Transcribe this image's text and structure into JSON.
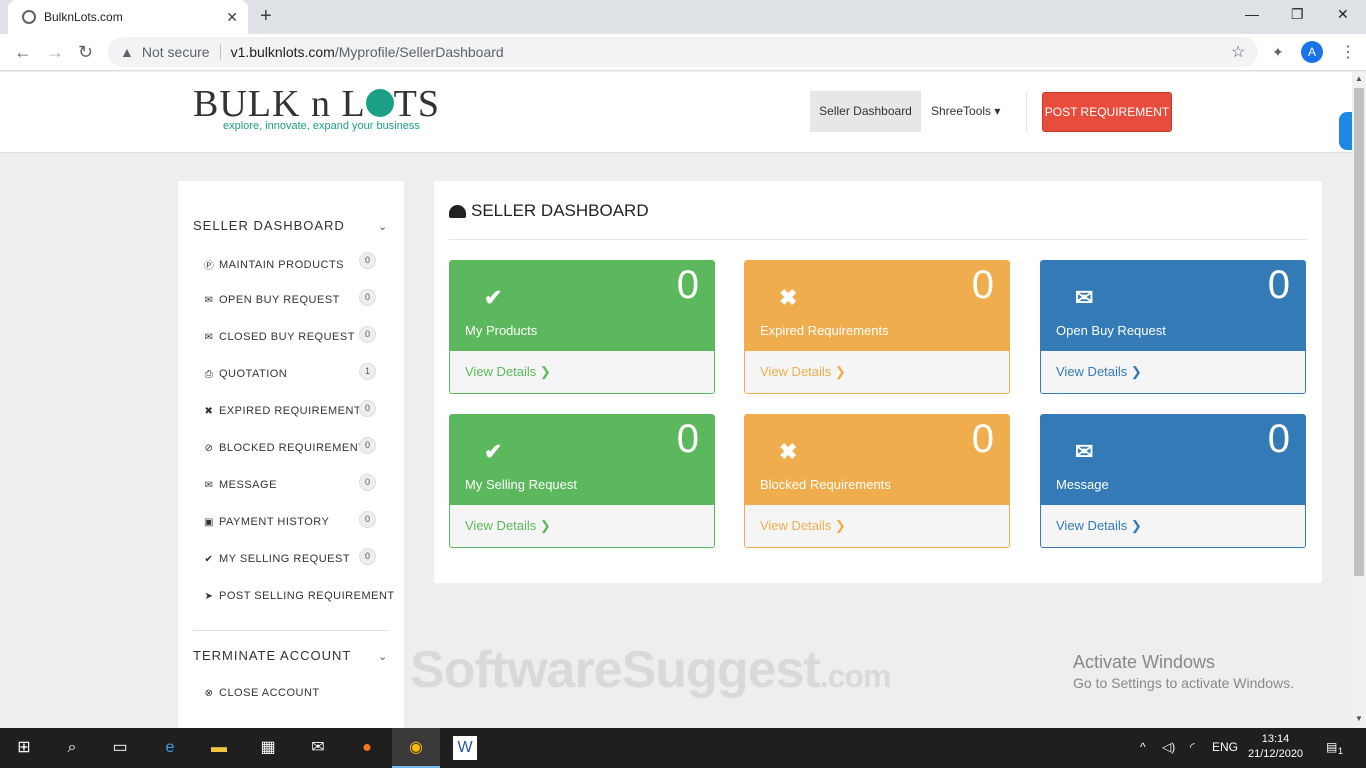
{
  "browser": {
    "tab_title": "BulknLots.com",
    "new_tab": "+",
    "not_secure": "Not secure",
    "url_host": "v1.bulknlots.com",
    "url_path": "/Myprofile/SellerDashboard",
    "profile_initial": "A",
    "window_controls": [
      "—",
      "❐",
      "✕"
    ]
  },
  "header": {
    "logo_part1": "BULK n L",
    "logo_part2": "TS",
    "tagline": "explore, innovate, expand your business",
    "nav_active": "Seller Dashboard",
    "user_menu": "ShreeTools ▾",
    "post_button": "POST REQUIREMENT"
  },
  "sidebar": {
    "section1": "SELLER DASHBOARD",
    "items": [
      {
        "icon": "Ⓟ",
        "label": "MAINTAIN PRODUCTS",
        "badge": "0"
      },
      {
        "icon": "✉",
        "label": "OPEN BUY REQUEST",
        "badge": "0"
      },
      {
        "icon": "✉",
        "label": "CLOSED BUY REQUEST",
        "badge": "0"
      },
      {
        "icon": "⎙",
        "label": "QUOTATION",
        "badge": "1"
      },
      {
        "icon": "✖",
        "label": "EXPIRED REQUIREMENTS",
        "badge": "0"
      },
      {
        "icon": "⊘",
        "label": "BLOCKED REQUIREMENTS",
        "badge": "0"
      },
      {
        "icon": "✉",
        "label": "MESSAGE",
        "badge": "0"
      },
      {
        "icon": "▣",
        "label": "PAYMENT HISTORY",
        "badge": "0"
      },
      {
        "icon": "✔",
        "label": "MY SELLING REQUEST",
        "badge": "0"
      },
      {
        "icon": "➤",
        "label": "POST SELLING REQUIREMENT",
        "badge": ""
      }
    ],
    "section2": "TERMINATE ACCOUNT",
    "close_account_icon": "⊗",
    "close_account": "CLOSE ACCOUNT"
  },
  "main": {
    "title": "SELLER DASHBOARD",
    "cards": [
      {
        "title": "My Products",
        "count": "0",
        "icon": "✔",
        "link": "View Details ❯"
      },
      {
        "title": "Expired Requirements",
        "count": "0",
        "icon": "✖",
        "link": "View Details ❯"
      },
      {
        "title": "Open Buy Request",
        "count": "0",
        "icon": "✉",
        "link": "View Details ❯"
      },
      {
        "title": "My Selling Request",
        "count": "0",
        "icon": "✔",
        "link": "View Details ❯"
      },
      {
        "title": "Blocked Requirements",
        "count": "0",
        "icon": "✖",
        "link": "View Details ❯"
      },
      {
        "title": "Message",
        "count": "0",
        "icon": "✉",
        "link": "View Details ❯"
      }
    ]
  },
  "overlay": {
    "watermark": "SoftwareSuggest",
    "watermark_suffix": ".com",
    "activate_line1": "Activate Windows",
    "activate_line2": "Go to Settings to activate Windows."
  },
  "taskbar": {
    "lang": "ENG",
    "time": "13:14",
    "date": "21/12/2020",
    "notifications": "1"
  }
}
